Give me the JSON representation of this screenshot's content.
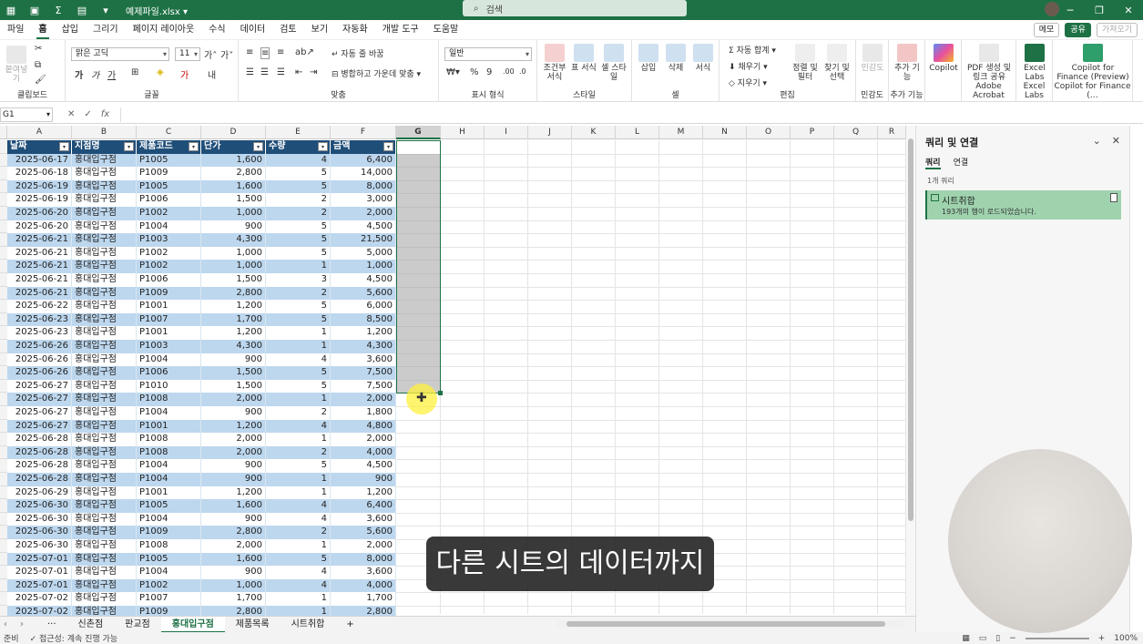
{
  "titlebar": {
    "filename": "예제파일.xlsx",
    "search_placeholder": "검색"
  },
  "menu": {
    "tabs": [
      "파일",
      "홈",
      "삽입",
      "그리기",
      "페이지 레이아웃",
      "수식",
      "데이터",
      "검토",
      "보기",
      "자동화",
      "개발 도구",
      "도움말"
    ],
    "active": "홈",
    "memo": "메모",
    "share": "공유",
    "get": "가져오기"
  },
  "ribbon": {
    "clipboard": {
      "label": "클립보드",
      "paste": "붙여넣기"
    },
    "font": {
      "label": "글꼴",
      "name": "맑은 고딕",
      "size": "11"
    },
    "align": {
      "label": "맞춤",
      "wrap": "자동 줄 바꿈",
      "merge": "병합하고 가운데 맞춤"
    },
    "number": {
      "label": "표시 형식",
      "format": "일반"
    },
    "style": {
      "label": "스타일",
      "cond": "조건부 서식",
      "table": "표 서식",
      "cell": "셀 스타일"
    },
    "cells": {
      "label": "셀",
      "insert": "삽입",
      "delete": "삭제",
      "format": "서식"
    },
    "edit": {
      "label": "편집",
      "autosum": "자동 합계",
      "fill": "채우기",
      "clear": "지우기",
      "sort": "정렬 및 필터",
      "find": "찾기 및 선택"
    },
    "sens": {
      "label": "민감도",
      "btn": "민감도"
    },
    "addins": {
      "label": "추가 기능",
      "btn": "추가 기능"
    },
    "copilot": "Copilot",
    "acrobat": {
      "label": "Adobe Acrobat",
      "btn": "PDF 생성 및 링크 공유"
    },
    "excellabs": {
      "label": "Excel Labs",
      "btn": "Excel Labs"
    },
    "copilotfin": {
      "label": "Copilot for Finance (…",
      "btn": "Copilot for Finance (Preview)"
    }
  },
  "formula_bar": {
    "namebox": "G1",
    "fx": "fx"
  },
  "columns": [
    "A",
    "B",
    "C",
    "D",
    "E",
    "F",
    "G",
    "H",
    "I",
    "J",
    "K",
    "L",
    "M",
    "N",
    "O",
    "P",
    "Q",
    "R"
  ],
  "table": {
    "headers": [
      "날짜",
      "지점명",
      "제품코드",
      "단가",
      "수량",
      "금액"
    ],
    "rows": [
      [
        "2025-06-17",
        "홍대입구점",
        "P1005",
        "1,600",
        "4",
        "6,400"
      ],
      [
        "2025-06-18",
        "홍대입구점",
        "P1009",
        "2,800",
        "5",
        "14,000"
      ],
      [
        "2025-06-19",
        "홍대입구점",
        "P1005",
        "1,600",
        "5",
        "8,000"
      ],
      [
        "2025-06-19",
        "홍대입구점",
        "P1006",
        "1,500",
        "2",
        "3,000"
      ],
      [
        "2025-06-20",
        "홍대입구점",
        "P1002",
        "1,000",
        "2",
        "2,000"
      ],
      [
        "2025-06-20",
        "홍대입구점",
        "P1004",
        "900",
        "5",
        "4,500"
      ],
      [
        "2025-06-21",
        "홍대입구점",
        "P1003",
        "4,300",
        "5",
        "21,500"
      ],
      [
        "2025-06-21",
        "홍대입구점",
        "P1002",
        "1,000",
        "5",
        "5,000"
      ],
      [
        "2025-06-21",
        "홍대입구점",
        "P1002",
        "1,000",
        "1",
        "1,000"
      ],
      [
        "2025-06-21",
        "홍대입구점",
        "P1006",
        "1,500",
        "3",
        "4,500"
      ],
      [
        "2025-06-21",
        "홍대입구점",
        "P1009",
        "2,800",
        "2",
        "5,600"
      ],
      [
        "2025-06-22",
        "홍대입구점",
        "P1001",
        "1,200",
        "5",
        "6,000"
      ],
      [
        "2025-06-23",
        "홍대입구점",
        "P1007",
        "1,700",
        "5",
        "8,500"
      ],
      [
        "2025-06-23",
        "홍대입구점",
        "P1001",
        "1,200",
        "1",
        "1,200"
      ],
      [
        "2025-06-26",
        "홍대입구점",
        "P1003",
        "4,300",
        "1",
        "4,300"
      ],
      [
        "2025-06-26",
        "홍대입구점",
        "P1004",
        "900",
        "4",
        "3,600"
      ],
      [
        "2025-06-26",
        "홍대입구점",
        "P1006",
        "1,500",
        "5",
        "7,500"
      ],
      [
        "2025-06-27",
        "홍대입구점",
        "P1010",
        "1,500",
        "5",
        "7,500"
      ],
      [
        "2025-06-27",
        "홍대입구점",
        "P1008",
        "2,000",
        "1",
        "2,000"
      ],
      [
        "2025-06-27",
        "홍대입구점",
        "P1004",
        "900",
        "2",
        "1,800"
      ],
      [
        "2025-06-27",
        "홍대입구점",
        "P1001",
        "1,200",
        "4",
        "4,800"
      ],
      [
        "2025-06-28",
        "홍대입구점",
        "P1008",
        "2,000",
        "1",
        "2,000"
      ],
      [
        "2025-06-28",
        "홍대입구점",
        "P1008",
        "2,000",
        "2",
        "4,000"
      ],
      [
        "2025-06-28",
        "홍대입구점",
        "P1004",
        "900",
        "5",
        "4,500"
      ],
      [
        "2025-06-28",
        "홍대입구점",
        "P1004",
        "900",
        "1",
        "900"
      ],
      [
        "2025-06-29",
        "홍대입구점",
        "P1001",
        "1,200",
        "1",
        "1,200"
      ],
      [
        "2025-06-30",
        "홍대입구점",
        "P1005",
        "1,600",
        "4",
        "6,400"
      ],
      [
        "2025-06-30",
        "홍대입구점",
        "P1004",
        "900",
        "4",
        "3,600"
      ],
      [
        "2025-06-30",
        "홍대입구점",
        "P1009",
        "2,800",
        "2",
        "5,600"
      ],
      [
        "2025-06-30",
        "홍대입구점",
        "P1008",
        "2,000",
        "1",
        "2,000"
      ],
      [
        "2025-07-01",
        "홍대입구점",
        "P1005",
        "1,600",
        "5",
        "8,000"
      ],
      [
        "2025-07-01",
        "홍대입구점",
        "P1004",
        "900",
        "4",
        "3,600"
      ],
      [
        "2025-07-01",
        "홍대입구점",
        "P1002",
        "1,000",
        "4",
        "4,000"
      ],
      [
        "2025-07-02",
        "홍대입구점",
        "P1007",
        "1,700",
        "1",
        "1,700"
      ],
      [
        "2025-07-02",
        "홍대입구점",
        "P1009",
        "2,800",
        "1",
        "2,800"
      ]
    ],
    "band_color": "#bdd7ee",
    "header_color": "#1f4e79"
  },
  "sheets": {
    "tabs": [
      "신촌점",
      "판교점",
      "홍대입구점",
      "제품목록",
      "시트취합"
    ],
    "active": "홍대입구점",
    "more": "···",
    "add": "+"
  },
  "status": {
    "ready": "준비",
    "accessibility": "접근성: 계속 진행 가능",
    "zoom": "100%"
  },
  "query_pane": {
    "title": "쿼리 및 연결",
    "tab_queries": "쿼리",
    "tab_connections": "연결",
    "count": "1개 쿼리",
    "query_name": "시트취합",
    "query_status": "193개의 행이 로드되었습니다."
  },
  "subtitle": "다른 시트의 데이터까지",
  "colors": {
    "excel_green": "#1e7145",
    "query_card": "#9fd3ae"
  }
}
